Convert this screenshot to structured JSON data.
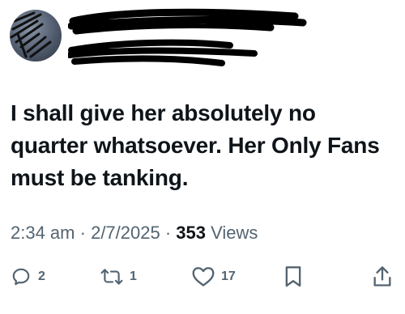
{
  "tweet": {
    "text": "I shall give her absolutely no quarter whatsoever. Her Only Fans must be tanking.",
    "time": "2:34 am",
    "separator": "·",
    "date": "2/7/2025",
    "views_count": "353",
    "views_label": "Views"
  },
  "actions": {
    "replies": "2",
    "retweets": "1",
    "likes": "17"
  },
  "icons": {
    "reply": "reply-icon",
    "retweet": "retweet-icon",
    "like": "heart-icon",
    "bookmark": "bookmark-icon",
    "share": "share-icon"
  },
  "colors": {
    "text": "#0f1419",
    "secondary": "#536471",
    "scribble": "#000000"
  }
}
